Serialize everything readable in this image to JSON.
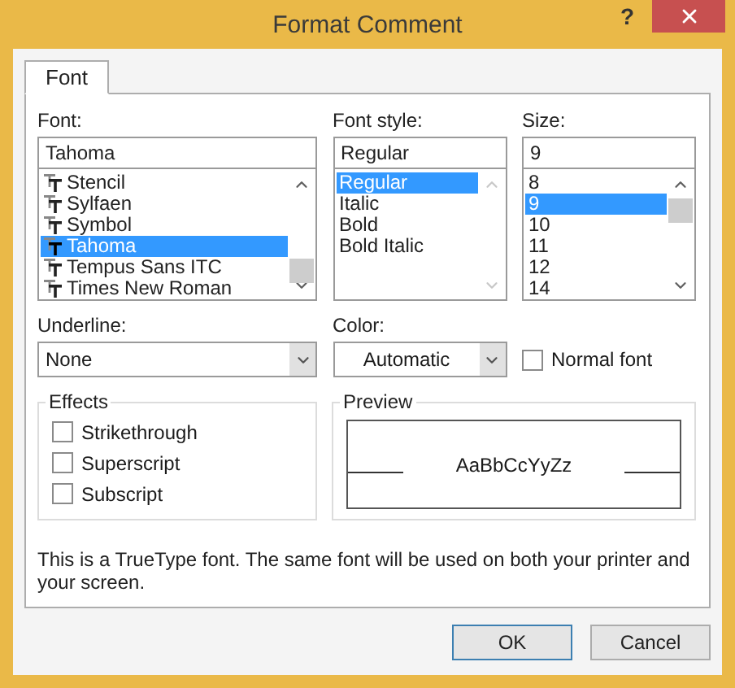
{
  "window": {
    "title": "Format Comment",
    "help": "?"
  },
  "tabs": [
    {
      "label": "Font",
      "selected": true
    }
  ],
  "font": {
    "label": "Font:",
    "value": "Tahoma",
    "items": [
      {
        "name": "Stencil",
        "selected": false
      },
      {
        "name": "Sylfaen",
        "selected": false
      },
      {
        "name": "Symbol",
        "selected": false
      },
      {
        "name": "Tahoma",
        "selected": true
      },
      {
        "name": "Tempus Sans ITC",
        "selected": false
      },
      {
        "name": "Times New Roman",
        "selected": false
      }
    ]
  },
  "font_style": {
    "label": "Font style:",
    "value": "Regular",
    "items": [
      {
        "name": "Regular",
        "selected": true
      },
      {
        "name": "Italic",
        "selected": false
      },
      {
        "name": "Bold",
        "selected": false
      },
      {
        "name": "Bold Italic",
        "selected": false
      }
    ]
  },
  "size": {
    "label": "Size:",
    "value": "9",
    "items": [
      {
        "name": "8",
        "selected": false
      },
      {
        "name": "9",
        "selected": true
      },
      {
        "name": "10",
        "selected": false
      },
      {
        "name": "11",
        "selected": false
      },
      {
        "name": "12",
        "selected": false
      },
      {
        "name": "14",
        "selected": false
      }
    ]
  },
  "underline": {
    "label": "Underline:",
    "value": "None"
  },
  "color": {
    "label": "Color:",
    "value": "Automatic"
  },
  "normal_font": {
    "label": "Normal font",
    "checked": false
  },
  "effects": {
    "title": "Effects",
    "options": [
      {
        "label": "Strikethrough",
        "checked": false
      },
      {
        "label": "Superscript",
        "checked": false
      },
      {
        "label": "Subscript",
        "checked": false
      }
    ]
  },
  "preview": {
    "title": "Preview",
    "sample": "AaBbCcYyZz"
  },
  "description": "This is a TrueType font.  The same font will be used on both your printer and your screen.",
  "buttons": [
    {
      "label": "OK",
      "default": true
    },
    {
      "label": "Cancel",
      "default": false
    }
  ]
}
